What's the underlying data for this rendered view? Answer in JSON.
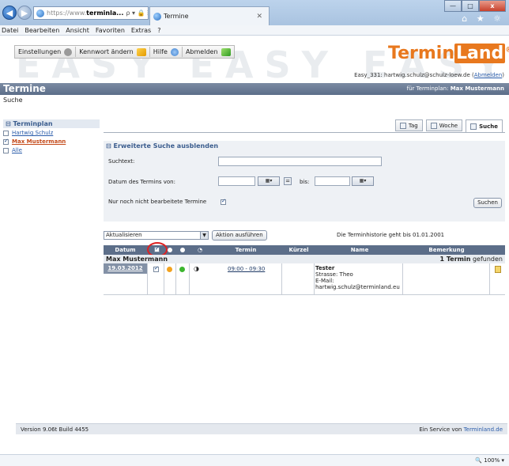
{
  "browser": {
    "url_prefix": "https://www.",
    "url_domain": "terminla...",
    "address_icons": "ρ ▾ 🔒 ☰ C ✕",
    "tab_title": "Termine",
    "tab_close": "✕",
    "window_controls": [
      "—",
      "□",
      "x"
    ],
    "right_icons": "⌂ ★ ☼"
  },
  "menu": [
    "Datei",
    "Bearbeiten",
    "Ansicht",
    "Favoriten",
    "Extras",
    "?"
  ],
  "toolbar": {
    "settings": "Einstellungen",
    "change_password": "Kennwort ändern",
    "help": "Hilfe",
    "logout": "Abmelden"
  },
  "header": {
    "background_text": "EASY EASY EASY EAS",
    "logo_text": "Termin",
    "logo_box": "Land",
    "logo_reg": "®",
    "user_line": "Easy_331: hartwig.schulz@schulz-loew.de",
    "logout_link": "Abmelden",
    "page_title": "Termine",
    "termplan_label": "für Terminplan:",
    "termplan_name": "Max Mustermann",
    "subtitle": "Suche"
  },
  "sidebar": {
    "title": "Terminplan",
    "items": [
      {
        "label": "Hartwig Schulz",
        "checked": false
      },
      {
        "label": "Max Mustermann",
        "checked": true
      },
      {
        "label": "Alle",
        "checked": false
      }
    ]
  },
  "tabs": [
    {
      "label": "Tag"
    },
    {
      "label": "Woche"
    },
    {
      "label": "Suche"
    }
  ],
  "search": {
    "toggle": "Erweiterte Suche ausblenden",
    "text_label": "Suchtext:",
    "date_label": "Datum des Termins von:",
    "bis_label": "bis:",
    "eq": "=",
    "only_label": "Nur noch nicht bearbeitete Termine",
    "submit": "Suchen"
  },
  "actions": {
    "select_value": "Aktualisieren",
    "run": "Aktion ausführen",
    "history": "Die Terminhistorie geht bis 01.01.2001"
  },
  "table": {
    "headers": {
      "datum": "Datum",
      "termin": "Termin",
      "kuerzel": "Kürzel",
      "name": "Name",
      "bemerkung": "Bemerkung"
    },
    "group": {
      "name": "Max Mustermann",
      "count": "1 Termin",
      "found": "gefunden"
    },
    "rows": [
      {
        "date": "19.03.2012",
        "time": "09:00 - 09:30",
        "name": "Tester",
        "street": "Strasse: Theo",
        "email_label": "E-Mail:",
        "email": "hartwig.schulz@terminland.eu"
      }
    ]
  },
  "footer": {
    "version": "Version 9.06t Build 4455",
    "service_prefix": "Ein Service von",
    "service_link": "Terminland.de"
  },
  "status": {
    "zoom": "🔍 100%  ▾"
  },
  "colors": {
    "brand_orange": "#e8781e",
    "header_bar": "#5c6e89",
    "link": "#2a5caa",
    "highlight": "#dd2222"
  }
}
